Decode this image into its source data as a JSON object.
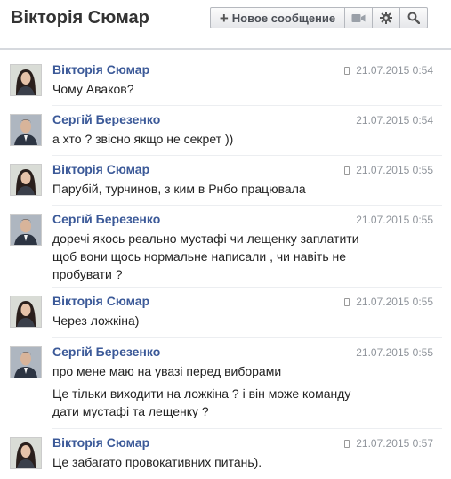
{
  "header": {
    "title": "Вікторія Сюмар",
    "new_message_label": "Новое сообщение"
  },
  "messages": [
    {
      "sender": "Вікторія Сюмар",
      "time": "21.07.2015 0:54",
      "mobile": true,
      "lines": [
        "Чому Аваков?"
      ]
    },
    {
      "sender": "Сергій Березенко",
      "time": "21.07.2015 0:54",
      "mobile": false,
      "lines": [
        "а хто ? звісно якщо не секрет ))"
      ]
    },
    {
      "sender": "Вікторія Сюмар",
      "time": "21.07.2015 0:55",
      "mobile": true,
      "lines": [
        "Парубій, турчинов, з ким в Рнбо працювала"
      ]
    },
    {
      "sender": "Сергій Березенко",
      "time": "21.07.2015 0:55",
      "mobile": false,
      "lines": [
        "доречі якось реально мустафі чи лещенку заплатити",
        "щоб вони щось нормальне написали , чи навіть не",
        "пробувати ?"
      ]
    },
    {
      "sender": "Вікторія Сюмар",
      "time": "21.07.2015 0:55",
      "mobile": true,
      "lines": [
        "Через ложкіна)"
      ]
    },
    {
      "sender": "Сергій Березенко",
      "time": "21.07.2015 0:55",
      "mobile": false,
      "lines": [
        "про мене маю на увазі перед виборами"
      ]
    },
    {
      "sender": "",
      "time": "",
      "mobile": false,
      "lines": [
        "Це тільки виходити на ложкіна ? і він може команду",
        "дати мустафі та лещенку ?"
      ]
    },
    {
      "sender": "Вікторія Сюмар",
      "time": "21.07.2015 0:57",
      "mobile": true,
      "lines": [
        "Це забагато провокативних питань)."
      ]
    }
  ],
  "icons": {
    "new_message": "plus-icon",
    "video": "video-camera-icon",
    "settings": "gear-icon",
    "search": "search-icon",
    "mobile": "mobile-phone-icon"
  },
  "colors": {
    "sender": "#3b5998",
    "time": "#8f949b"
  }
}
